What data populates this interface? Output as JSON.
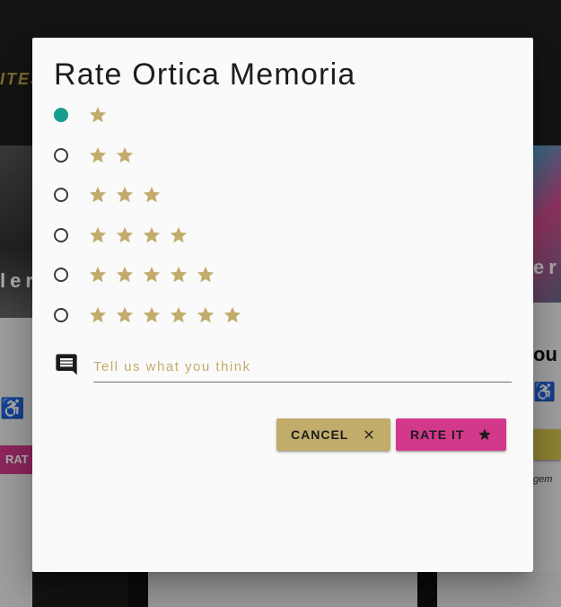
{
  "background": {
    "logo_text": "ITES",
    "left_card": {
      "overlay_text": "ler",
      "rate_label": "RAT"
    },
    "right_card": {
      "overlay_text": "er",
      "title": "ou",
      "small_text": "gem"
    }
  },
  "dialog": {
    "title": "Rate Ortica Memoria",
    "selected_rating": 1,
    "options": [
      {
        "stars": 1,
        "checked": true
      },
      {
        "stars": 2,
        "checked": false
      },
      {
        "stars": 3,
        "checked": false
      },
      {
        "stars": 4,
        "checked": false
      },
      {
        "stars": 5,
        "checked": false
      },
      {
        "stars": 6,
        "checked": false
      }
    ],
    "comment": {
      "placeholder": "Tell us what you think",
      "value": "",
      "icon": "comment-icon"
    },
    "buttons": {
      "cancel_label": "CANCEL",
      "cancel_icon": "close-icon",
      "rate_label": "RATE IT",
      "rate_icon": "star-icon"
    }
  },
  "colors": {
    "accent_gold": "#c2ac6b",
    "accent_pink": "#d2398a",
    "radio_checked": "#179d8c",
    "dialog_bg": "#fafafa"
  }
}
